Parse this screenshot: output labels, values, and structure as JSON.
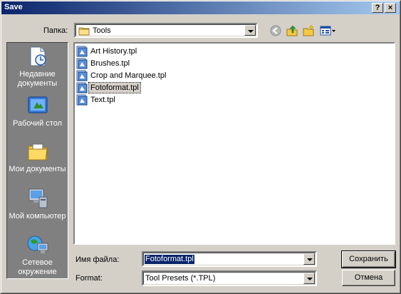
{
  "window": {
    "title": "Save",
    "help_button": "?",
    "close_button": "×"
  },
  "location": {
    "label": "Папка:",
    "value": "Tools"
  },
  "toolbar": {
    "icons": [
      "back-icon",
      "up-folder-icon",
      "new-folder-icon",
      "view-menu-icon"
    ]
  },
  "places": [
    {
      "label": "Недавние документы",
      "icon": "recent-documents-icon"
    },
    {
      "label": "Рабочий стол",
      "icon": "desktop-icon"
    },
    {
      "label": "Мои документы",
      "icon": "my-documents-icon"
    },
    {
      "label": "Мой компьютер",
      "icon": "my-computer-icon"
    },
    {
      "label": "Сетевое окружение",
      "icon": "network-places-icon"
    }
  ],
  "files": [
    {
      "name": "Art History.tpl"
    },
    {
      "name": "Brushes.tpl"
    },
    {
      "name": "Crop and Marquee.tpl"
    },
    {
      "name": "Fotoformat.tpl",
      "selected": true
    },
    {
      "name": "Text.tpl"
    }
  ],
  "filename": {
    "label": "Имя файла:",
    "value": "Fotoformat.tpl"
  },
  "format": {
    "label": "Format:",
    "value": "Tool Presets (*.TPL)"
  },
  "buttons": {
    "save": "Сохранить",
    "cancel": "Отмена"
  },
  "colors": {
    "title_start": "#0a246a",
    "title_end": "#a6caf0",
    "selection": "#0a246a",
    "face": "#d4d0c8"
  }
}
